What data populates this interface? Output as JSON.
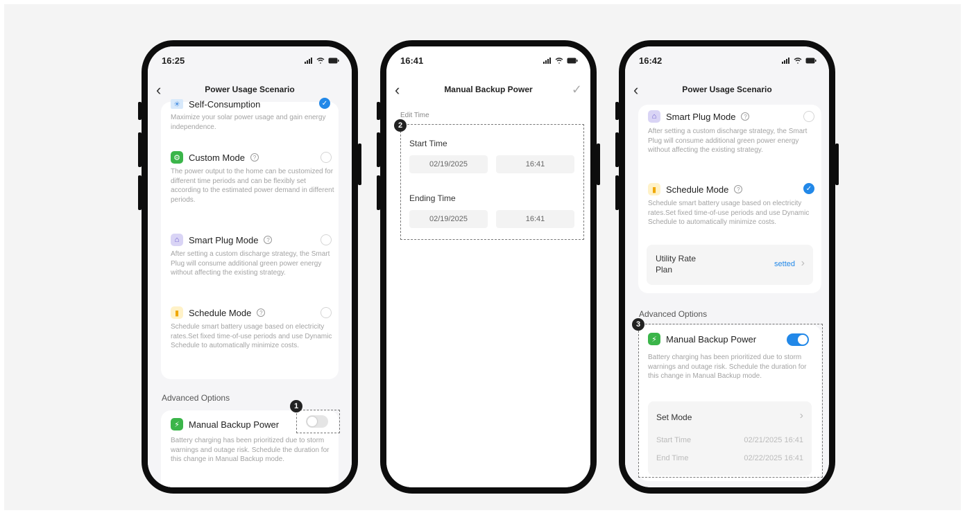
{
  "phone1": {
    "time": "16:25",
    "title": "Power Usage Scenario",
    "self_consumption": {
      "title": "Self-Consumption",
      "desc": "Maximize your solar power usage and gain energy independence."
    },
    "custom": {
      "title": "Custom Mode",
      "desc": "The power output to the home can be customized for different time periods and can be flexibly set according to the estimated power demand in different periods."
    },
    "smart_plug": {
      "title": "Smart Plug Mode",
      "desc": "After setting a custom discharge strategy, the Smart Plug will consume additional green power energy without affecting the existing strategy."
    },
    "schedule": {
      "title": "Schedule Mode",
      "desc": "Schedule smart battery usage based on electricity rates.Set fixed time-of-use periods and use Dynamic Schedule to automatically minimize costs."
    },
    "advanced_label": "Advanced Options",
    "backup": {
      "title": "Manual Backup Power",
      "desc": "Battery charging has been prioritized due to storm warnings and outage risk. Schedule the duration for this change in Manual Backup mode."
    },
    "badge": "1"
  },
  "phone2": {
    "time": "16:41",
    "title": "Manual Backup Power",
    "edit_label": "Edit Time",
    "start_label": "Start Time",
    "start_date": "02/19/2025",
    "start_time": "16:41",
    "end_label": "Ending Time",
    "end_date": "02/19/2025",
    "end_time": "16:41",
    "badge": "2"
  },
  "phone3": {
    "time": "16:42",
    "title": "Power Usage Scenario",
    "smart_plug": {
      "title": "Smart Plug Mode",
      "desc": "After setting a custom discharge strategy, the Smart Plug will consume additional green power energy without affecting the existing strategy."
    },
    "schedule": {
      "title": "Schedule Mode",
      "desc": "Schedule smart battery usage based on electricity rates.Set fixed time-of-use periods and use Dynamic Schedule to automatically minimize costs."
    },
    "utility_label": "Utility Rate Plan",
    "utility_value": "setted",
    "advanced_label": "Advanced Options",
    "backup": {
      "title": "Manual Backup Power",
      "desc": "Battery charging has been prioritized due to storm warnings and outage risk. Schedule the duration for this change in Manual Backup mode."
    },
    "set_mode": "Set Mode",
    "start_label": "Start Time",
    "start_value": "02/21/2025 16:41",
    "end_label": "End Time",
    "end_value": "02/22/2025 16:41",
    "badge": "3"
  },
  "colors": {
    "accent": "#2288e8",
    "green": "#3bb54a",
    "frame": "#0d0d0d"
  }
}
